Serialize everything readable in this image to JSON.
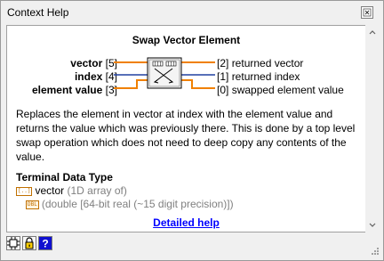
{
  "window": {
    "title": "Context Help"
  },
  "help": {
    "vi_title": "Swap Vector Element",
    "inputs": [
      {
        "name": "vector",
        "index": "[5]"
      },
      {
        "name": "index",
        "index": "[4]"
      },
      {
        "name": "element value",
        "index": "[3]"
      }
    ],
    "outputs": [
      {
        "index": "[2]",
        "name": "returned vector"
      },
      {
        "index": "[1]",
        "name": "returned index"
      },
      {
        "index": "[0]",
        "name": "swapped element value"
      }
    ],
    "description": "Replaces the element in vector at index with the element value and returns the value which was previously there.  This is done by a top level swap operation which does not need to deep copy any contents of the value.",
    "terminal_data_type": {
      "heading": "Terminal Data Type",
      "row1_name": "vector",
      "row1_type": " (1D array of)",
      "row2_type": "(double [64-bit real (~15 digit precision)])"
    },
    "detailed_help_label": "Detailed help"
  },
  "colors": {
    "orange_wire": "#f08000",
    "blue_wire": "#2040a0",
    "link": "#0000ff",
    "help_icon_blue": "#1010d0"
  },
  "icons": [
    "close-icon",
    "vi-connector-icon",
    "scroll-up-icon",
    "scroll-down-icon",
    "lock-help-icon",
    "show-optional-terminals-icon",
    "help-question-icon",
    "resize-grip-icon"
  ]
}
